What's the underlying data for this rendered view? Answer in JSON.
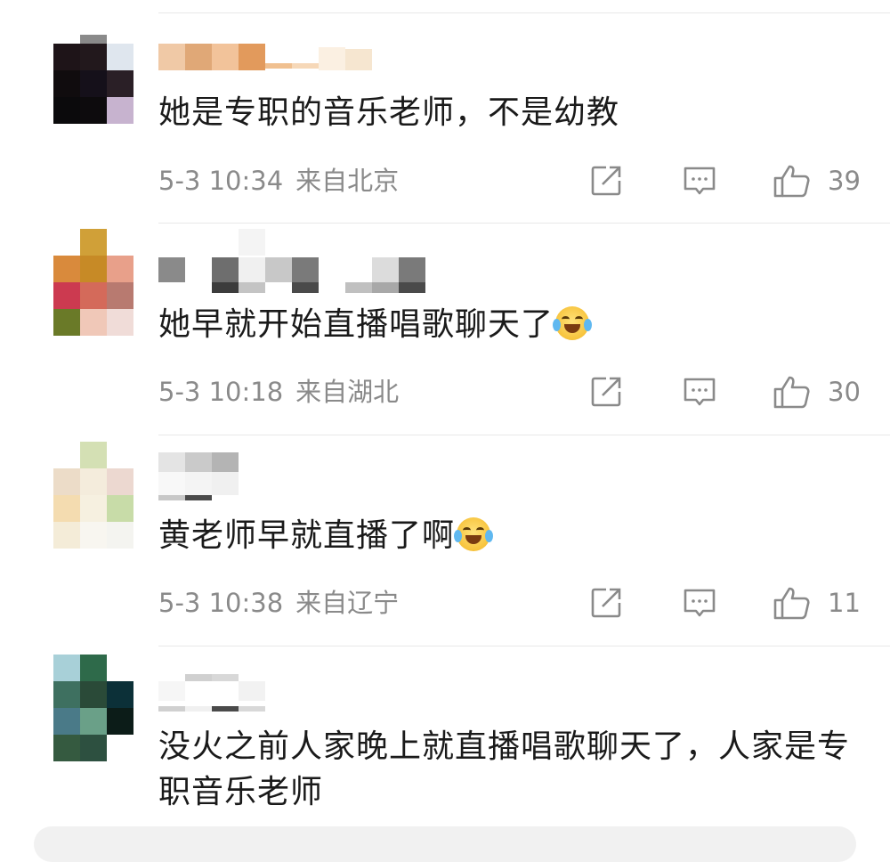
{
  "comments": [
    {
      "user": "",
      "text": "她是专职的音乐老师，不是幼教",
      "date": "5-3 10:34",
      "location": "来自北京",
      "likes": "39",
      "avatar_colors": [
        "#1e1418",
        "#22181c",
        "#dfe6ee",
        "#100c0e",
        "#15101a",
        "#2a1f26",
        "#0b0a0c",
        "#0d0b0d",
        "#c7b3cf"
      ]
    },
    {
      "user": "",
      "text": "她早就开始直播唱歌聊天了",
      "emoji": "laugh-cry-icon",
      "date": "5-3 10:18",
      "location": "来自湖北",
      "likes": "30",
      "avatar_colors": [
        "#d98a3c",
        "#c78a26",
        "#e8a08a",
        "#cc3a50",
        "#d46a5a",
        "#b87a70",
        "#6a7a28",
        "#f0c8b8",
        "#f0dcd8"
      ]
    },
    {
      "user": "",
      "text": "黄老师早就直播了啊",
      "emoji": "laugh-cry-icon",
      "date": "5-3 10:38",
      "location": "来自辽宁",
      "likes": "11",
      "avatar_colors": [
        "#ecdcc8",
        "#f4ecdc",
        "#ecd8d0",
        "#f4dcb0",
        "#f6f0e0",
        "#c8dca8",
        "#f4ecd8",
        "#f8f6f0",
        "#f4f4f0"
      ]
    },
    {
      "user": "",
      "text": "没火之前人家晚上就直播唱歌聊天了，人家是专职音乐老师",
      "avatar_colors": [
        "#3e7060",
        "#2a4a38",
        "#0c3038",
        "#4a7a88",
        "#6aa088",
        "#0c1c18",
        "#355a40",
        "#2d5040",
        "#e8eee8"
      ]
    }
  ],
  "icons": {
    "share": "share-icon",
    "comment": "comment-icon",
    "like": "thumbs-up-icon"
  }
}
